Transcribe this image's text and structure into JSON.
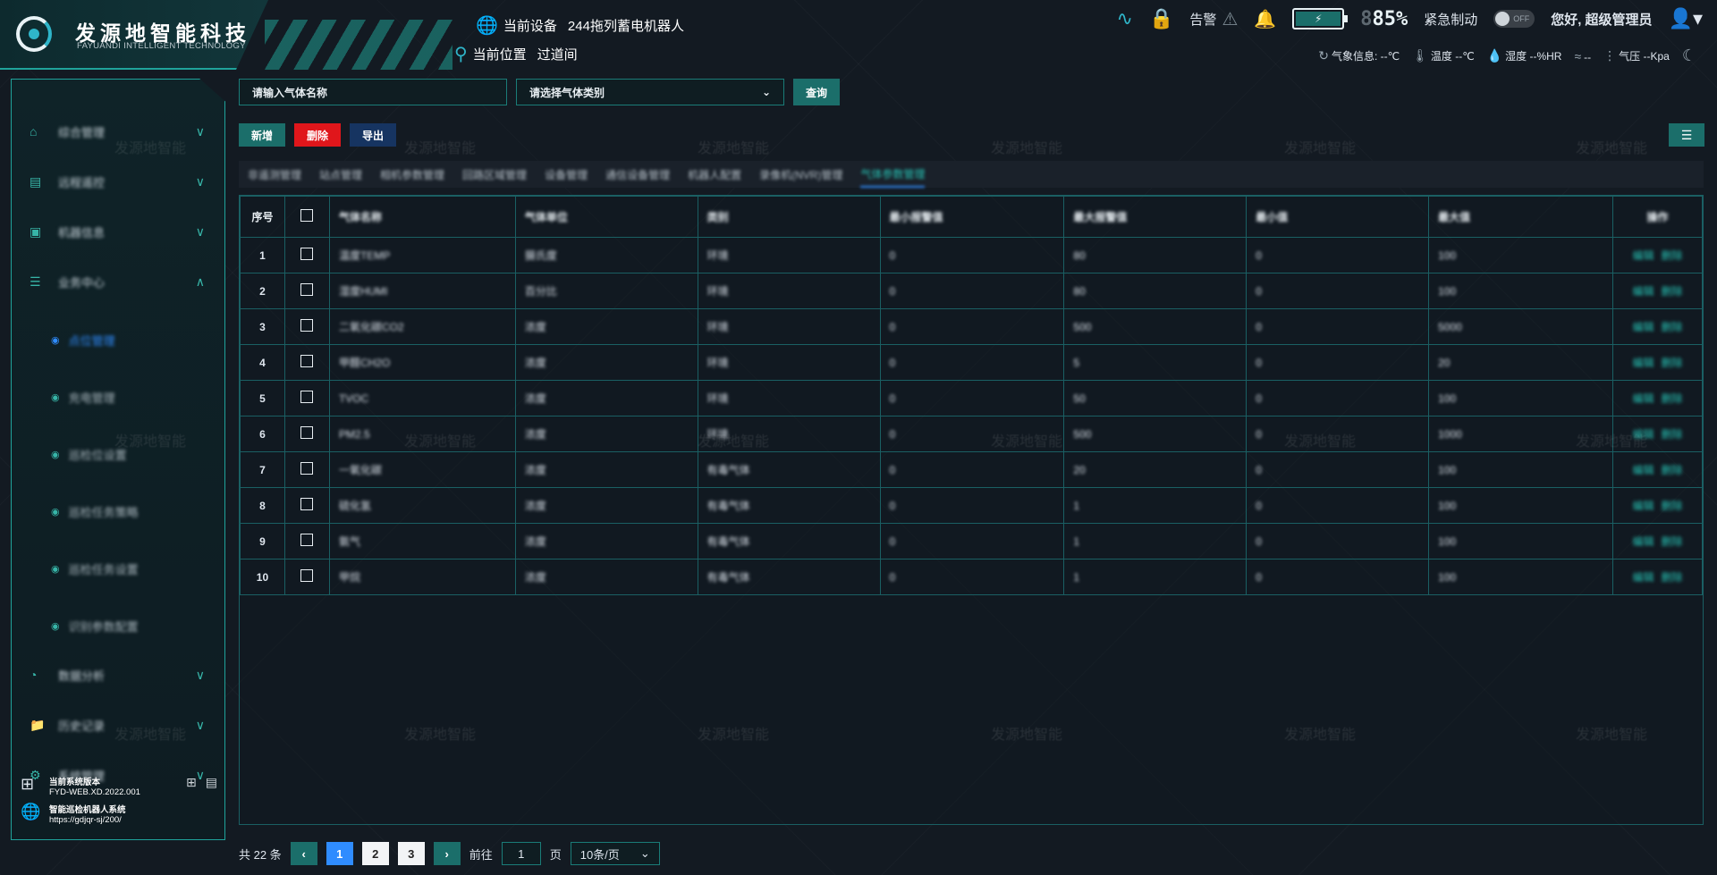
{
  "header": {
    "logo_cn": "发源地智能科技",
    "logo_en": "FAYUANDI INTELLIGENT TECHNOLOGY",
    "device_label": "当前设备",
    "device_value": "244拖列蓄电机器人",
    "location_label": "当前位置",
    "location_value": "过道间",
    "alarm_label": "告警",
    "battery_percent": "85%",
    "emergency_label": "紧急制动",
    "toggle_label": "OFF",
    "greeting": "您好,  超级管理员",
    "weather": {
      "info_label": "气象信息: --℃",
      "temp_label": "温度 --℃",
      "humidity_label": "湿度 --%HR",
      "wind_label": "--",
      "pressure_label": "气压 --Kpa"
    }
  },
  "sidebar": {
    "items": [
      {
        "label": "综合管理",
        "icon": "home-icon"
      },
      {
        "label": "远程遥控",
        "icon": "monitor-icon"
      },
      {
        "label": "机器信息",
        "icon": "robot-icon"
      },
      {
        "label": "业务中心",
        "icon": "stack-icon"
      }
    ],
    "sub_items": [
      {
        "label": "点位管理"
      },
      {
        "label": "充电管理"
      },
      {
        "label": "巡检位设置"
      },
      {
        "label": "巡检任务策略"
      },
      {
        "label": "巡检任务设置"
      },
      {
        "label": "识别参数配置"
      }
    ],
    "bottom_items": [
      {
        "label": "数据分析",
        "icon": "chart-icon"
      },
      {
        "label": "历史记录",
        "icon": "folder-icon"
      },
      {
        "label": "系统管理",
        "icon": "gear-icon"
      }
    ],
    "footer": {
      "version_label": "当前系统版本",
      "version": "FYD-WEB.XD.2022.001",
      "system_name": "智能巡检机器人系统",
      "url": "https://gdjqr-sj/200/"
    }
  },
  "search": {
    "name_placeholder": "请输入气体名称",
    "type_placeholder": "请选择气体类别",
    "query_label": "查询"
  },
  "actions": {
    "add_label": "新增",
    "delete_label": "删除",
    "export_label": "导出"
  },
  "tabs": [
    "非遥测管理",
    "站点管理",
    "相机参数管理",
    "回路区域管理",
    "设备管理",
    "通信设备管理",
    "机器人配置",
    "录像机(NVR)管理",
    "气体参数管理"
  ],
  "table": {
    "headers": [
      "序号",
      "",
      "气体名称",
      "气体单位",
      "类别",
      "最小报警值",
      "最大报警值",
      "最小值",
      "最大值",
      "操作"
    ],
    "rows": [
      {
        "idx": "1",
        "name": "温度TEMP",
        "unit": "摄氏度",
        "cat": "环境",
        "minw": "0",
        "maxw": "80",
        "min": "0",
        "max": "100"
      },
      {
        "idx": "2",
        "name": "湿度HUMI",
        "unit": "百分比",
        "cat": "环境",
        "minw": "0",
        "maxw": "80",
        "min": "0",
        "max": "100"
      },
      {
        "idx": "3",
        "name": "二氧化碳CO2",
        "unit": "浓度",
        "cat": "环境",
        "minw": "0",
        "maxw": "500",
        "min": "0",
        "max": "5000"
      },
      {
        "idx": "4",
        "name": "甲醛CH2O",
        "unit": "浓度",
        "cat": "环境",
        "minw": "0",
        "maxw": "5",
        "min": "0",
        "max": "20"
      },
      {
        "idx": "5",
        "name": "TVOC",
        "unit": "浓度",
        "cat": "环境",
        "minw": "0",
        "maxw": "50",
        "min": "0",
        "max": "100"
      },
      {
        "idx": "6",
        "name": "PM2.5",
        "unit": "浓度",
        "cat": "环境",
        "minw": "0",
        "maxw": "500",
        "min": "0",
        "max": "1000"
      },
      {
        "idx": "7",
        "name": "一氧化碳",
        "unit": "浓度",
        "cat": "有毒气体",
        "minw": "0",
        "maxw": "20",
        "min": "0",
        "max": "100"
      },
      {
        "idx": "8",
        "name": "硫化氢",
        "unit": "浓度",
        "cat": "有毒气体",
        "minw": "0",
        "maxw": "1",
        "min": "0",
        "max": "100"
      },
      {
        "idx": "9",
        "name": "氨气",
        "unit": "浓度",
        "cat": "有毒气体",
        "minw": "0",
        "maxw": "1",
        "min": "0",
        "max": "100"
      },
      {
        "idx": "10",
        "name": "甲烷",
        "unit": "浓度",
        "cat": "有毒气体",
        "minw": "0",
        "maxw": "1",
        "min": "0",
        "max": "100"
      }
    ],
    "op_edit": "编辑",
    "op_delete": "删除"
  },
  "pager": {
    "total_label": "共 22 条",
    "pages": [
      "1",
      "2",
      "3"
    ],
    "goto_label": "前往",
    "goto_value": "1",
    "page_unit": "页",
    "size_label": "10条/页"
  },
  "watermark_text": "发源地智能",
  "colors": {
    "accent_teal": "#1b6e6a",
    "accent_blue": "#2f8cff",
    "danger_red": "#e0161b",
    "navy": "#163461"
  }
}
